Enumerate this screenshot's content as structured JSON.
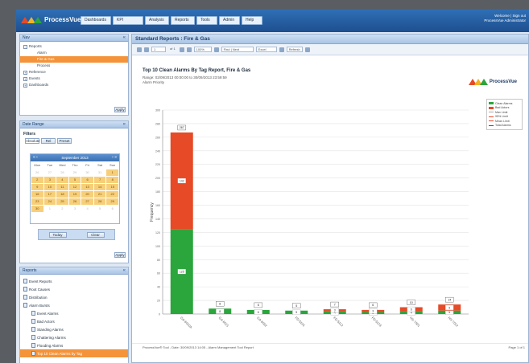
{
  "app": {
    "name": "ProcessVue"
  },
  "menu": [
    "Dashboards",
    "KPI",
    "Analysis",
    "Reports",
    "Tools",
    "Admin",
    "Help"
  ],
  "user": {
    "line1": "Welcome | Sign out",
    "line2": "ProcessVue Administrator"
  },
  "nav_panel": {
    "title": "Nav",
    "items": [
      {
        "label": "Reports",
        "box": "−",
        "selected": false
      },
      {
        "label": "Alarm",
        "box": "",
        "selected": false
      },
      {
        "label": "Fire & Gas",
        "box": "",
        "selected": true
      },
      {
        "label": "Process",
        "box": "",
        "selected": false
      },
      {
        "label": "Reference",
        "box": "+",
        "selected": false
      },
      {
        "label": "Events",
        "box": "+",
        "selected": false
      },
      {
        "label": "Dashboards",
        "box": "+",
        "selected": false
      }
    ],
    "apply_label": "Apply"
  },
  "date_panel": {
    "title": "Date Range",
    "label": "Filters",
    "tabs": [
      "Absolute",
      "Rel",
      "Preset"
    ],
    "month": "September 2013",
    "weekdays": [
      "Mon",
      "Tue",
      "Wed",
      "Thu",
      "Fri",
      "Sat",
      "Sun"
    ],
    "days": [
      "26",
      "27",
      "28",
      "29",
      "30",
      "31",
      "1",
      "2",
      "3",
      "4",
      "5",
      "6",
      "7",
      "8",
      "9",
      "10",
      "11",
      "12",
      "13",
      "14",
      "15",
      "16",
      "17",
      "18",
      "19",
      "20",
      "21",
      "22",
      "23",
      "24",
      "25",
      "26",
      "27",
      "28",
      "29",
      "30",
      "1",
      "2",
      "3",
      "4",
      "5",
      "6"
    ],
    "today_label": "Today",
    "clear_label": "Clear",
    "apply_label": "Apply"
  },
  "report_panel": {
    "title": "Reports",
    "items": [
      {
        "label": "Event Reports",
        "selected": false
      },
      {
        "label": "Root Causes",
        "selected": false
      },
      {
        "label": "Distribution",
        "selected": false
      },
      {
        "label": "Alarm Bursts",
        "selected": false
      },
      {
        "label": "Event Alarms",
        "selected": false
      },
      {
        "label": "Bad Actors",
        "selected": false
      },
      {
        "label": "Standing Alarms",
        "selected": false
      },
      {
        "label": "Chattering Alarms",
        "selected": false
      },
      {
        "label": "Flooding Alarms",
        "selected": false
      },
      {
        "label": "Top 10 Clean Alarms by Tag",
        "selected": true
      }
    ]
  },
  "main": {
    "header": "Standard Reports : Fire & Gas",
    "toolbar": {
      "page": "1",
      "of": "of 1",
      "zoom": "100%",
      "find": "Find | Next",
      "export": "Excel",
      "refresh": "Refresh"
    },
    "chart_title": "Top 10 Clean Alarms By Tag Report, Fire & Gas",
    "sub1": "Range: 02/09/2013 00:00:00 to 30/09/2013 23:59:59",
    "sub2": "Alarm Priority",
    "footer": "ProcessVue® Tool - Date: 30/09/2013 14:05 - Alarm Management Tool Report",
    "page_info": "Page 1 of 1"
  },
  "chart_data": {
    "type": "bar",
    "categories": [
      "GA-6010A",
      "GA-6021",
      "GA-6032",
      "FD-5101",
      "FD-5112",
      "FD-5123",
      "HS-7001",
      "HS-7012"
    ],
    "series": [
      {
        "name": "Clean Alarms",
        "color": "#2aa63c",
        "values": [
          125,
          8,
          6,
          5,
          4,
          3,
          4,
          5
        ]
      },
      {
        "name": "Bad Actors",
        "color": "#e64a27",
        "values": [
          142,
          0,
          0,
          0,
          3,
          3,
          6,
          9
        ]
      }
    ],
    "extra_legend": [
      {
        "name": "Max Limit",
        "color": "#aaaaaa"
      },
      {
        "name": "95% Limit",
        "color": "#e64a27"
      },
      {
        "name": "Mean Limit",
        "color": "#e64a27"
      },
      {
        "name": "Total Alarms",
        "color": "#555555"
      }
    ],
    "totals": [
      267,
      8,
      6,
      5,
      7,
      6,
      10,
      14
    ],
    "ylim": [
      0,
      300
    ],
    "ylabel": "Frequency",
    "grid": true,
    "legend_position": "right"
  }
}
